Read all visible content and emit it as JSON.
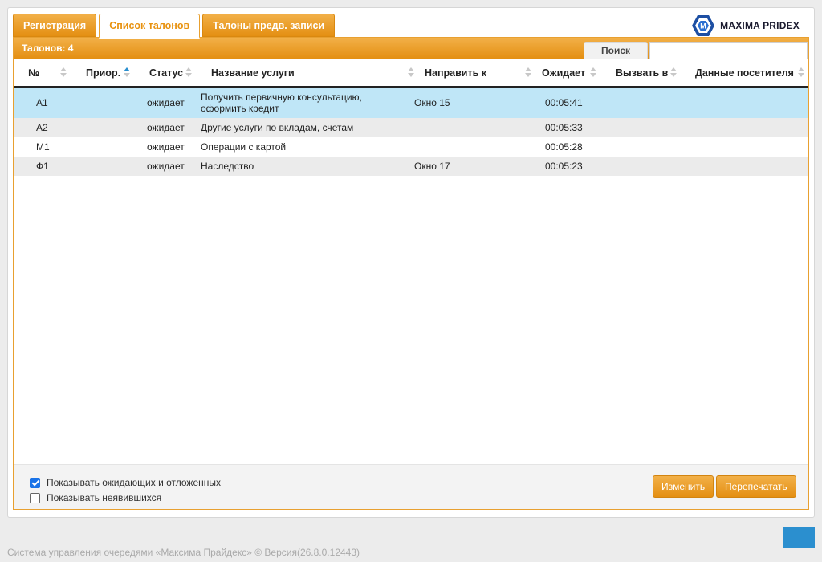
{
  "tabs": [
    {
      "label": "Регистрация",
      "active": false
    },
    {
      "label": "Список талонов",
      "active": true
    },
    {
      "label": "Талоны предв. записи",
      "active": false
    }
  ],
  "logo": {
    "text": "MAXIMA PRIDEX",
    "icon": "maxima-hexagon-logo",
    "color": "#1d4fa3"
  },
  "panel": {
    "count_label": "Талонов: 4",
    "search_label": "Поиск",
    "search_value": ""
  },
  "table": {
    "columns": [
      "№",
      "Приор.",
      "Статус",
      "Название услуги",
      "Направить к",
      "Ожидает",
      "Вызвать в",
      "Данные посетителя"
    ],
    "sorted_column": "Приор.",
    "rows": [
      {
        "num": "А1",
        "prior": "",
        "status": "ожидает",
        "service": "Получить первичную консультацию, оформить кредит",
        "direct": "Окно 15",
        "wait": "00:05:41",
        "call": "",
        "visitor": ""
      },
      {
        "num": "А2",
        "prior": "",
        "status": "ожидает",
        "service": "Другие услуги по вкладам, счетам",
        "direct": "",
        "wait": "00:05:33",
        "call": "",
        "visitor": ""
      },
      {
        "num": "М1",
        "prior": "",
        "status": "ожидает",
        "service": "Операции с картой",
        "direct": "",
        "wait": "00:05:28",
        "call": "",
        "visitor": ""
      },
      {
        "num": "Ф1",
        "prior": "",
        "status": "ожидает",
        "service": "Наследство",
        "direct": "Окно 17",
        "wait": "00:05:23",
        "call": "",
        "visitor": ""
      }
    ]
  },
  "footer": {
    "show_waiting_label": "Показывать ожидающих и отложенных",
    "show_waiting_checked": true,
    "show_absent_label": "Показывать неявившихся",
    "show_absent_checked": false,
    "edit_button": "Изменить",
    "reprint_button": "Перепечатать"
  },
  "status_bar": "Система управления очередями «Максима Прайдекс» © Версия(26.8.0.12443)",
  "colors": {
    "accent": "#e8920f",
    "selected_row": "#bfe6f7",
    "blue_button": "#2b8fcf"
  }
}
